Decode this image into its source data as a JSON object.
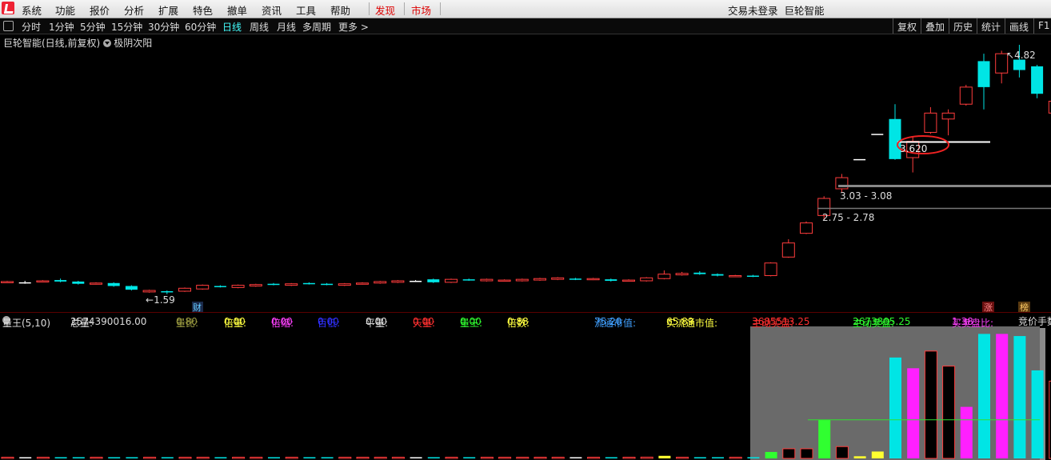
{
  "menubar": {
    "items": [
      "系统",
      "功能",
      "报价",
      "分析",
      "扩展",
      "特色",
      "撤单",
      "资讯",
      "工具",
      "帮助"
    ],
    "discover": "发现",
    "market": "市场",
    "status": "交易未登录",
    "app_name": "巨轮智能"
  },
  "toolbar": {
    "periods": [
      "分时",
      "1分钟",
      "5分钟",
      "15分钟",
      "30分钟",
      "60分钟",
      "日线",
      "周线",
      "月线",
      "多周期",
      "更多"
    ],
    "active_period": "日线",
    "more_arrow": ">",
    "right_buttons": [
      "复权",
      "叠加",
      "历史",
      "统计",
      "画线",
      "F1"
    ]
  },
  "chart": {
    "title": "巨轮智能(日线,前复权)",
    "indicator": "极阴次阳",
    "low_label": "1.59",
    "high_label": "4.82",
    "level_mid": "3.620",
    "range_upper": "3.03 - 3.08",
    "range_lower": "2.75 - 2.78",
    "badge_cai": "财",
    "badge_zhang": "涨",
    "badge_bang": "榜",
    "colors": {
      "up": "#ff3c3c",
      "down": "#00e5e5",
      "flat": "#ffffff"
    }
  },
  "sub": {
    "name": "量王(5,10)",
    "total_label": "总量:",
    "total_value": "2574390016.00",
    "liangbi_label": "量比:",
    "liangbi_value": "0.80",
    "beiliang_label": "倍量:",
    "beiliang_value": "0.00",
    "beisuo_label": "倍缩:",
    "beisuo_value": "0.00",
    "baidi_label": "百低:",
    "baidi_value": "0.00",
    "pingliang_label": "平量:",
    "pingliang_value": "0.00",
    "tianliang_label": "天量:",
    "tianliang_value": "0.00",
    "liangwang_label": "量王:",
    "liangwang_value": "0.00",
    "beishu_label": "倍数:",
    "beishu_value": "0.88",
    "ltsz_label": "流通市值:",
    "ltsz_value": "75.20",
    "sltsz_label": "实流通市值:",
    "sltsz_value": "65.89",
    "zdmp_label": "主动买盘:",
    "zdmp_value": "3685513.25",
    "zdmpo_label": "主动卖盘:",
    "zdmpo_value": "2673805.25",
    "mmpb_label": "买卖盘比:",
    "mmpb_value": "1.38",
    "jjsc_label": "竞价手数"
  },
  "chart_data": {
    "type": "candlestick",
    "low_marker": 1.59,
    "high_marker": 4.82,
    "candles": [
      {
        "o": 1.62,
        "c": 1.63,
        "h": 1.64,
        "l": 1.61
      },
      {
        "o": 1.62,
        "c": 1.62,
        "h": 1.64,
        "l": 1.6
      },
      {
        "o": 1.63,
        "c": 1.64,
        "h": 1.65,
        "l": 1.62
      },
      {
        "o": 1.65,
        "c": 1.63,
        "h": 1.67,
        "l": 1.62
      },
      {
        "o": 1.63,
        "c": 1.6,
        "h": 1.64,
        "l": 1.59
      },
      {
        "o": 1.6,
        "c": 1.61,
        "h": 1.62,
        "l": 1.59
      },
      {
        "o": 1.61,
        "c": 1.57,
        "h": 1.62,
        "l": 1.56
      },
      {
        "o": 1.57,
        "c": 1.52,
        "h": 1.58,
        "l": 1.51
      },
      {
        "o": 1.49,
        "c": 1.51,
        "h": 1.52,
        "l": 1.48
      },
      {
        "o": 1.5,
        "c": 1.49,
        "h": 1.51,
        "l": 1.46
      },
      {
        "o": 1.5,
        "c": 1.54,
        "h": 1.55,
        "l": 1.49
      },
      {
        "o": 1.53,
        "c": 1.58,
        "h": 1.59,
        "l": 1.52
      },
      {
        "o": 1.57,
        "c": 1.56,
        "h": 1.58,
        "l": 1.55
      },
      {
        "o": 1.55,
        "c": 1.58,
        "h": 1.59,
        "l": 1.54
      },
      {
        "o": 1.57,
        "c": 1.59,
        "h": 1.6,
        "l": 1.56
      },
      {
        "o": 1.6,
        "c": 1.59,
        "h": 1.61,
        "l": 1.58
      },
      {
        "o": 1.58,
        "c": 1.6,
        "h": 1.61,
        "l": 1.57
      },
      {
        "o": 1.61,
        "c": 1.6,
        "h": 1.62,
        "l": 1.59
      },
      {
        "o": 1.6,
        "c": 1.59,
        "h": 1.61,
        "l": 1.58
      },
      {
        "o": 1.58,
        "c": 1.6,
        "h": 1.61,
        "l": 1.57
      },
      {
        "o": 1.6,
        "c": 1.61,
        "h": 1.62,
        "l": 1.59
      },
      {
        "o": 1.61,
        "c": 1.63,
        "h": 1.64,
        "l": 1.6
      },
      {
        "o": 1.62,
        "c": 1.64,
        "h": 1.65,
        "l": 1.61
      },
      {
        "o": 1.64,
        "c": 1.64,
        "h": 1.65,
        "l": 1.63
      },
      {
        "o": 1.66,
        "c": 1.62,
        "h": 1.67,
        "l": 1.61
      },
      {
        "o": 1.62,
        "c": 1.66,
        "h": 1.67,
        "l": 1.61
      },
      {
        "o": 1.66,
        "c": 1.65,
        "h": 1.67,
        "l": 1.64
      },
      {
        "o": 1.64,
        "c": 1.66,
        "h": 1.67,
        "l": 1.63
      },
      {
        "o": 1.64,
        "c": 1.65,
        "h": 1.66,
        "l": 1.63
      },
      {
        "o": 1.64,
        "c": 1.66,
        "h": 1.67,
        "l": 1.63
      },
      {
        "o": 1.65,
        "c": 1.67,
        "h": 1.68,
        "l": 1.64
      },
      {
        "o": 1.66,
        "c": 1.68,
        "h": 1.69,
        "l": 1.65
      },
      {
        "o": 1.67,
        "c": 1.66,
        "h": 1.68,
        "l": 1.65
      },
      {
        "o": 1.66,
        "c": 1.67,
        "h": 1.68,
        "l": 1.65
      },
      {
        "o": 1.66,
        "c": 1.64,
        "h": 1.67,
        "l": 1.63
      },
      {
        "o": 1.64,
        "c": 1.65,
        "h": 1.66,
        "l": 1.63
      },
      {
        "o": 1.64,
        "c": 1.68,
        "h": 1.69,
        "l": 1.63
      },
      {
        "o": 1.67,
        "c": 1.73,
        "h": 1.78,
        "l": 1.66
      },
      {
        "o": 1.72,
        "c": 1.74,
        "h": 1.76,
        "l": 1.71
      },
      {
        "o": 1.75,
        "c": 1.73,
        "h": 1.77,
        "l": 1.72
      },
      {
        "o": 1.73,
        "c": 1.71,
        "h": 1.74,
        "l": 1.7
      },
      {
        "o": 1.7,
        "c": 1.71,
        "h": 1.72,
        "l": 1.69
      },
      {
        "o": 1.71,
        "c": 1.7,
        "h": 1.72,
        "l": 1.69
      },
      {
        "o": 1.71,
        "c": 1.88,
        "h": 1.89,
        "l": 1.7
      },
      {
        "o": 1.96,
        "c": 2.15,
        "h": 2.2,
        "l": 1.95
      },
      {
        "o": 2.28,
        "c": 2.42,
        "h": 2.44,
        "l": 2.27
      },
      {
        "o": 2.52,
        "c": 2.75,
        "h": 2.78,
        "l": 2.45
      },
      {
        "o": 2.88,
        "c": 3.03,
        "h": 3.08,
        "l": 2.83
      },
      {
        "o": 3.28,
        "c": 3.28,
        "h": 3.28,
        "l": 3.28
      },
      {
        "o": 3.62,
        "c": 3.62,
        "h": 3.62,
        "l": 3.62
      },
      {
        "o": 3.82,
        "c": 3.28,
        "h": 4.02,
        "l": 3.27
      },
      {
        "o": 3.3,
        "c": 3.52,
        "h": 3.58,
        "l": 3.1
      },
      {
        "o": 3.64,
        "c": 3.9,
        "h": 3.98,
        "l": 3.62
      },
      {
        "o": 3.82,
        "c": 3.9,
        "h": 3.95,
        "l": 3.6
      },
      {
        "o": 4.02,
        "c": 4.25,
        "h": 4.28,
        "l": 4.0
      },
      {
        "o": 4.6,
        "c": 4.25,
        "h": 4.7,
        "l": 3.95
      },
      {
        "o": 4.44,
        "c": 4.7,
        "h": 4.74,
        "l": 4.3
      },
      {
        "o": 4.62,
        "c": 4.48,
        "h": 4.82,
        "l": 4.38
      },
      {
        "o": 4.53,
        "c": 4.16,
        "h": 4.55,
        "l": 4.1
      },
      {
        "o": 3.9,
        "c": 4.06,
        "h": 4.2,
        "l": 3.88
      }
    ],
    "volume": [
      {
        "v": 0.4,
        "c": "up"
      },
      {
        "v": 0.3,
        "c": "flat"
      },
      {
        "v": 0.4,
        "c": "up"
      },
      {
        "v": 0.5,
        "c": "down"
      },
      {
        "v": 0.5,
        "c": "down"
      },
      {
        "v": 0.3,
        "c": "up"
      },
      {
        "v": 0.4,
        "c": "down"
      },
      {
        "v": 0.5,
        "c": "down"
      },
      {
        "v": 0.4,
        "c": "up"
      },
      {
        "v": 0.3,
        "c": "down"
      },
      {
        "v": 0.4,
        "c": "up"
      },
      {
        "v": 0.4,
        "c": "up"
      },
      {
        "v": 0.3,
        "c": "down"
      },
      {
        "v": 0.3,
        "c": "up"
      },
      {
        "v": 0.4,
        "c": "up"
      },
      {
        "v": 0.5,
        "c": "down"
      },
      {
        "v": 0.4,
        "c": "up"
      },
      {
        "v": 0.3,
        "c": "down"
      },
      {
        "v": 0.4,
        "c": "down"
      },
      {
        "v": 0.3,
        "c": "up"
      },
      {
        "v": 0.4,
        "c": "up"
      },
      {
        "v": 0.4,
        "c": "up"
      },
      {
        "v": 0.3,
        "c": "up"
      },
      {
        "v": 0.3,
        "c": "flat"
      },
      {
        "v": 0.5,
        "c": "down"
      },
      {
        "v": 0.4,
        "c": "up"
      },
      {
        "v": 0.3,
        "c": "down"
      },
      {
        "v": 0.3,
        "c": "up"
      },
      {
        "v": 0.3,
        "c": "up"
      },
      {
        "v": 0.3,
        "c": "up"
      },
      {
        "v": 0.3,
        "c": "up"
      },
      {
        "v": 0.3,
        "c": "up"
      },
      {
        "v": 0.3,
        "c": "flat"
      },
      {
        "v": 0.3,
        "c": "up"
      },
      {
        "v": 0.3,
        "c": "down"
      },
      {
        "v": 0.3,
        "c": "up"
      },
      {
        "v": 0.6,
        "c": "up"
      },
      {
        "v": 1.2,
        "c": "yellow"
      },
      {
        "v": 0.5,
        "c": "up"
      },
      {
        "v": 0.4,
        "c": "down"
      },
      {
        "v": 0.3,
        "c": "down"
      },
      {
        "v": 0.3,
        "c": "up"
      },
      {
        "v": 0.3,
        "c": "down"
      },
      {
        "v": 3.0,
        "c": "green"
      },
      {
        "v": 4.5,
        "c": "up"
      },
      {
        "v": 4.5,
        "c": "up"
      },
      {
        "v": 18,
        "c": "green"
      },
      {
        "v": 5.5,
        "c": "up"
      },
      {
        "v": 1.0,
        "c": "yellow"
      },
      {
        "v": 3.2,
        "c": "yellow"
      },
      {
        "v": 47,
        "c": "down"
      },
      {
        "v": 42,
        "c": "magenta"
      },
      {
        "v": 50,
        "c": "up"
      },
      {
        "v": 43,
        "c": "up"
      },
      {
        "v": 24,
        "c": "magenta"
      },
      {
        "v": 58,
        "c": "down"
      },
      {
        "v": 58,
        "c": "magenta"
      },
      {
        "v": 57,
        "c": "down"
      },
      {
        "v": 41,
        "c": "down"
      },
      {
        "v": 36,
        "c": "up"
      }
    ],
    "volume_ref_line": 18
  }
}
